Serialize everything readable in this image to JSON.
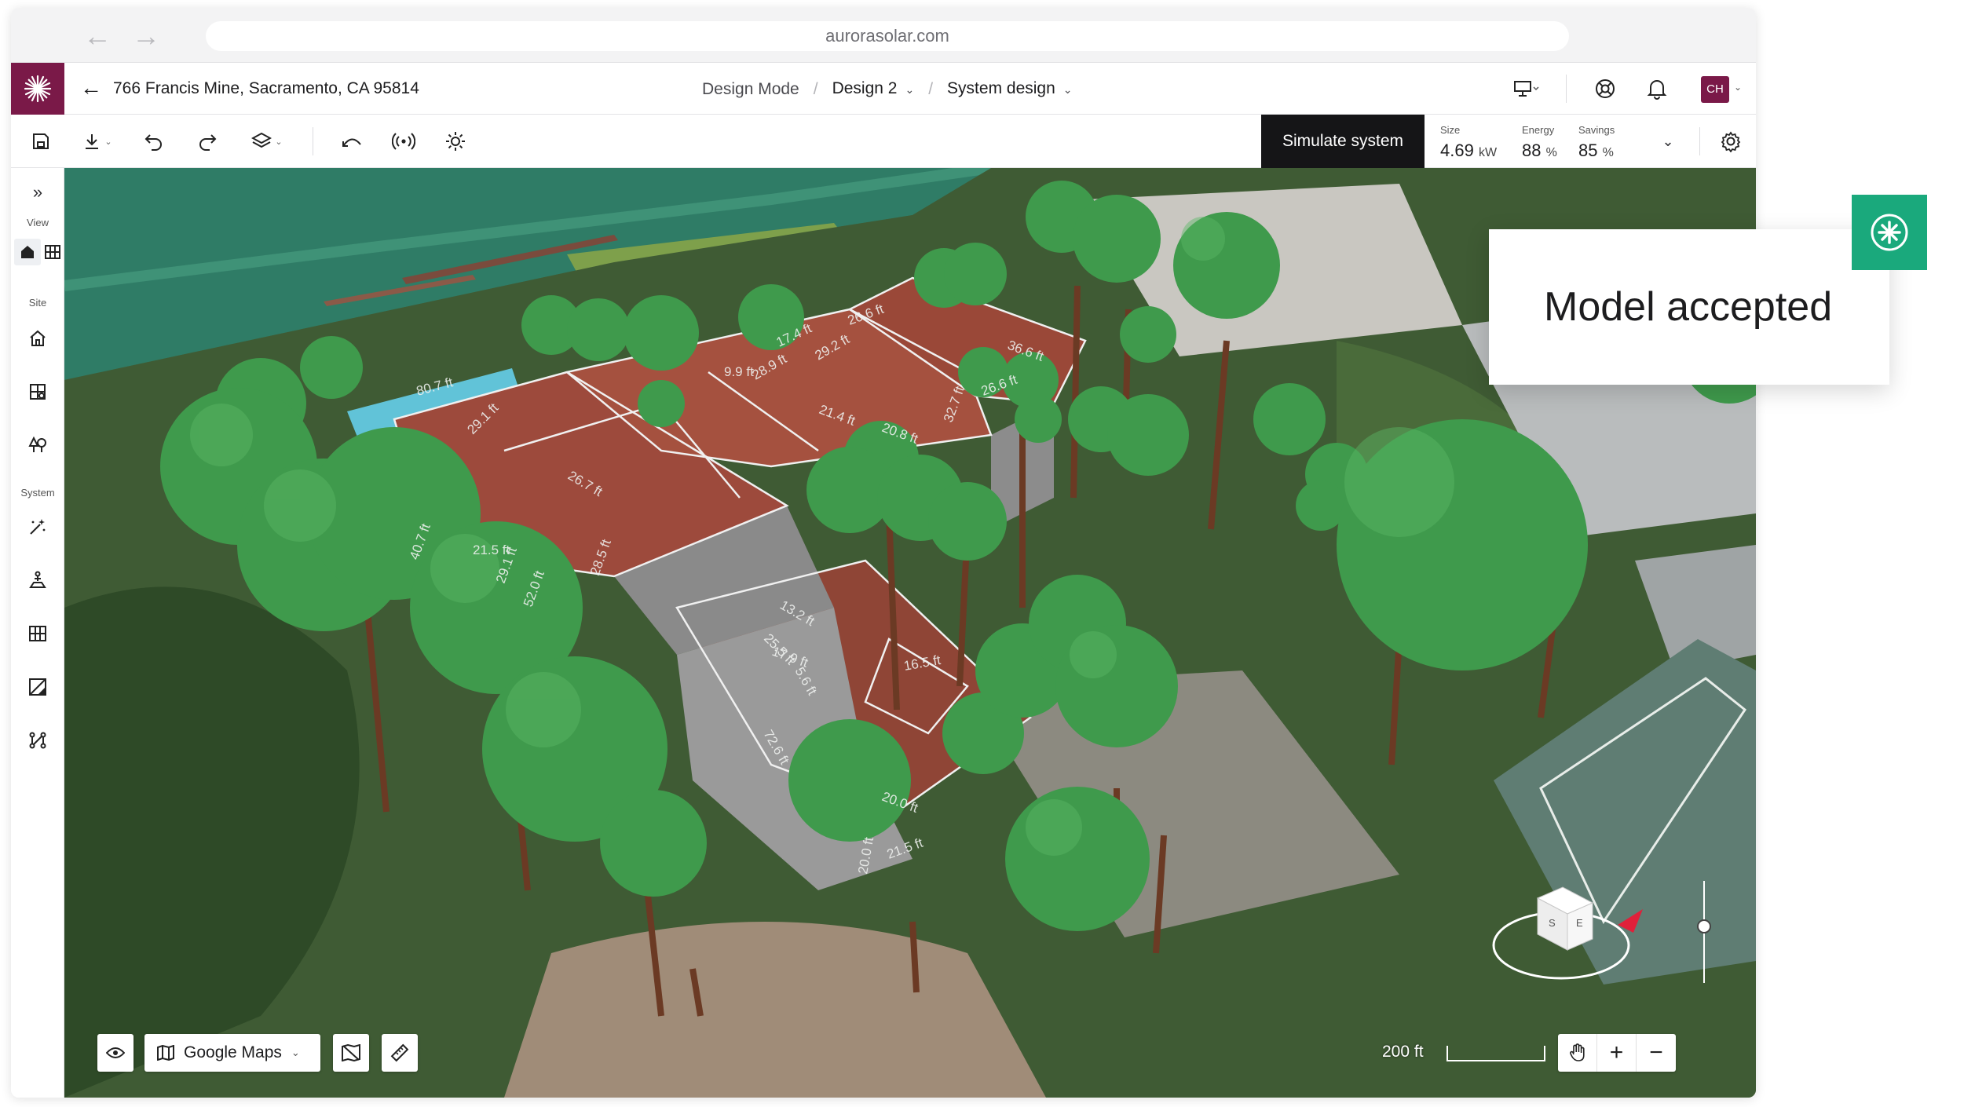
{
  "browser": {
    "url": "aurorasolar.com",
    "back_icon": "back-arrow-icon",
    "forward_icon": "forward-arrow-icon"
  },
  "header": {
    "logo_icon": "aurora-logo-icon",
    "address": "766 Francis Mine, Sacramento, CA 95814",
    "mode": "Design Mode",
    "design": "Design 2",
    "section": "System design",
    "avatar_initials": "CH",
    "brand_color": "#7a1948"
  },
  "toolbar": {
    "simulate_label": "Simulate system",
    "stats": [
      {
        "label": "Size",
        "value": "4.69",
        "unit": "kW"
      },
      {
        "label": "Energy",
        "value": "88",
        "unit": "%"
      },
      {
        "label": "Savings",
        "value": "85",
        "unit": "%"
      }
    ]
  },
  "sidebar": {
    "sections": {
      "view": "View",
      "site": "Site",
      "system": "System"
    }
  },
  "map": {
    "basemap_label": "Google Maps",
    "scale_label": "200 ft",
    "compass": {
      "s": "S",
      "e": "E"
    },
    "roof_labels": [
      "80.7 ft",
      "29.1 ft",
      "40.7 ft",
      "29.1 ft",
      "21.5 ft",
      "52.0 ft",
      "28.5 ft",
      "26.7 ft",
      "13.2 ft",
      "17.9 ft",
      "25.5 ft",
      "26.6 ft",
      "36.6 ft",
      "26.6 ft",
      "17.4 ft",
      "29.2 ft",
      "28.9 ft",
      "21.4 ft",
      "20.8 ft",
      "32.7 ft",
      "72.6 ft",
      "20.0 ft",
      "21.5 ft",
      "20.0 ft",
      "5.6 ft",
      "16.5 ft",
      "9.9 ft"
    ]
  },
  "toast": {
    "message": "Model accepted",
    "icon": "asterisk-icon",
    "accent": "#1aa97c"
  }
}
